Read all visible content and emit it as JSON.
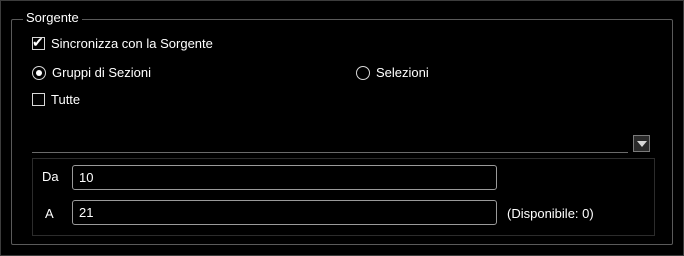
{
  "source_group": {
    "title": "Sorgente",
    "sync_checkbox": {
      "label": "Sincronizza con la Sorgente",
      "checked": true
    },
    "radio_groups": {
      "label": "Gruppi di Sezioni",
      "selected": true
    },
    "radio_selections": {
      "label": "Selezioni",
      "selected": false
    },
    "all_checkbox": {
      "label": "Tutte",
      "checked": false
    },
    "dropdown": {
      "value": "",
      "icon": "chevron-down-icon"
    },
    "from_field": {
      "label": "Da",
      "value": "10"
    },
    "to_field": {
      "label": "A",
      "value": "21"
    },
    "available_text": "(Disponibile: 0)"
  }
}
